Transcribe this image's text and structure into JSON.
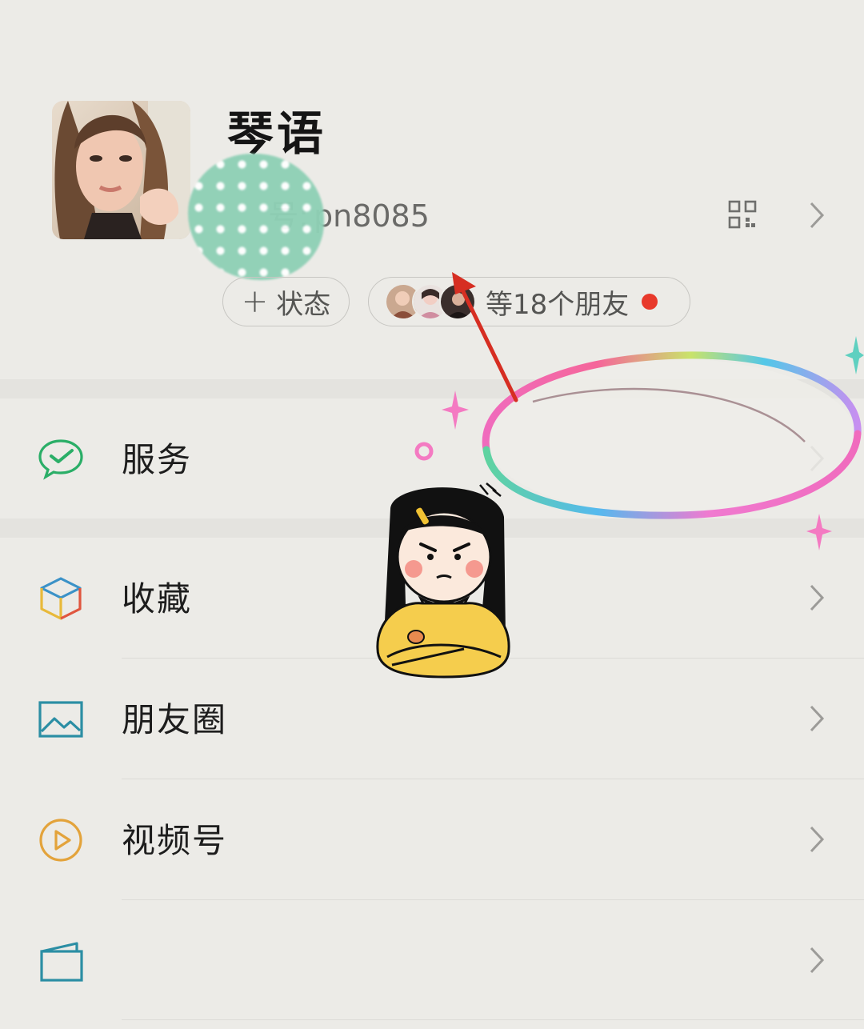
{
  "profile": {
    "nickname": "琴语",
    "wechat_id_prefix": "号:",
    "wechat_id": "pn8085",
    "status_button": "状态",
    "friends_summary": "等18个朋友"
  },
  "menu": [
    {
      "label": "服务",
      "icon": "wechat-pay-check-icon"
    },
    {
      "label": "收藏",
      "icon": "cube-icon"
    },
    {
      "label": "朋友圈",
      "icon": "image-icon"
    },
    {
      "label": "视频号",
      "icon": "play-circle-icon"
    },
    {
      "label": "",
      "icon": "card-wallet-icon"
    }
  ],
  "colors": {
    "background": "#ecebe7",
    "wechat_green": "#2aae67",
    "notification_red": "#e8392b",
    "annotation_arrow": "#d62e22"
  }
}
